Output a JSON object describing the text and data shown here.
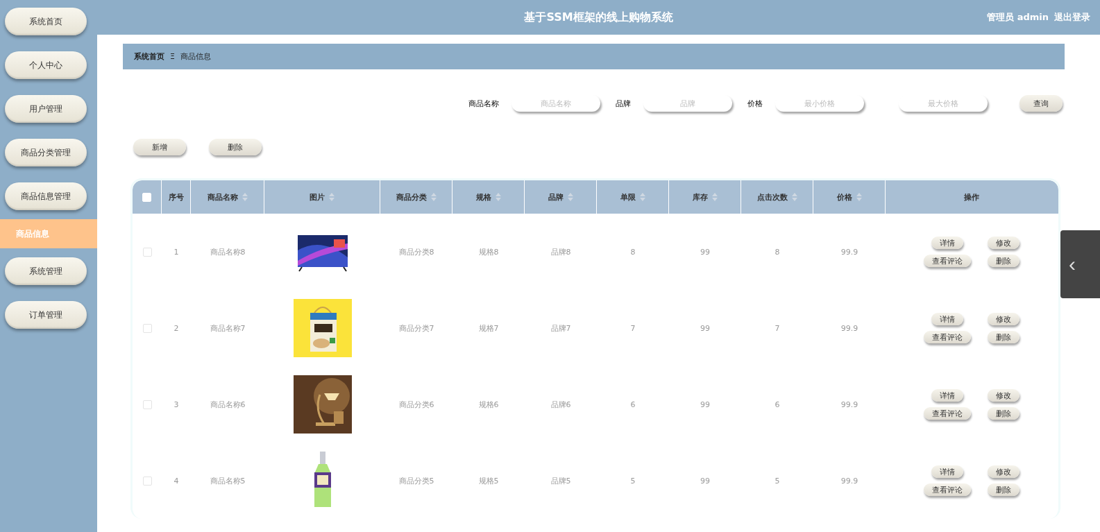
{
  "header": {
    "title": "基于SSM框架的线上购物系统",
    "user": "管理员 admin",
    "logout": "退出登录"
  },
  "sidebar": {
    "items": [
      {
        "label": "系统首页",
        "selected": false
      },
      {
        "label": "个人中心",
        "selected": false
      },
      {
        "label": "用户管理",
        "selected": false
      },
      {
        "label": "商品分类管理",
        "selected": false
      },
      {
        "label": "商品信息管理",
        "selected": false,
        "children": [
          {
            "label": "商品信息",
            "selected": true
          }
        ]
      },
      {
        "label": "系统管理",
        "selected": false
      },
      {
        "label": "订单管理",
        "selected": false
      }
    ]
  },
  "breadcrumb": [
    "系统首页",
    "商品信息"
  ],
  "breadcrumb_separator": "Ξ",
  "search": {
    "fields": [
      {
        "label": "商品名称",
        "placeholder": "商品名称"
      },
      {
        "label": "品牌",
        "placeholder": "品牌"
      },
      {
        "label": "价格",
        "placeholder": "最小价格"
      },
      {
        "placeholder": "最大价格"
      }
    ],
    "button": "查询"
  },
  "actions": [
    "新增",
    "删除"
  ],
  "table": {
    "select_all": {
      "checked": false
    },
    "columns": [
      {
        "label": "序号",
        "sortable": false
      },
      {
        "label": "商品名称",
        "sortable": true
      },
      {
        "label": "图片",
        "sortable": true
      },
      {
        "label": "商品分类",
        "sortable": true
      },
      {
        "label": "规格",
        "sortable": true
      },
      {
        "label": "品牌",
        "sortable": true
      },
      {
        "label": "单限",
        "sortable": true
      },
      {
        "label": "库存",
        "sortable": true
      },
      {
        "label": "点击次数",
        "sortable": true
      },
      {
        "label": "价格",
        "sortable": true
      },
      {
        "label": "操作",
        "sortable": false
      }
    ],
    "rows": [
      {
        "checked": false,
        "cells": [
          "1",
          "商品名称8",
          {
            "kind": "picture"
          },
          "商品分类8",
          "规格8",
          "品牌8",
          "8",
          "99",
          "8",
          "99.9"
        ],
        "buttons": [
          "详情",
          "修改",
          "查看评论",
          "删除"
        ]
      },
      {
        "checked": false,
        "cells": [
          "2",
          "商品名称7",
          {
            "kind": "picture"
          },
          "商品分类7",
          "规格7",
          "品牌7",
          "7",
          "99",
          "7",
          "99.9"
        ],
        "buttons": [
          "详情",
          "修改",
          "查看评论",
          "删除"
        ]
      },
      {
        "checked": false,
        "cells": [
          "3",
          "商品名称6",
          {
            "kind": "picture"
          },
          "商品分类6",
          "规格6",
          "品牌6",
          "6",
          "99",
          "6",
          "99.9"
        ],
        "buttons": [
          "详情",
          "修改",
          "查看评论",
          "删除"
        ]
      },
      {
        "checked": false,
        "cells": [
          "4",
          "商品名称5",
          {
            "kind": "picture"
          },
          "商品分类5",
          "规格5",
          "品牌5",
          "5",
          "99",
          "5",
          "99.9"
        ],
        "buttons": [
          "详情",
          "修改",
          "查看评论",
          "删除"
        ]
      }
    ]
  },
  "side_tab": {
    "icon": "‹"
  }
}
